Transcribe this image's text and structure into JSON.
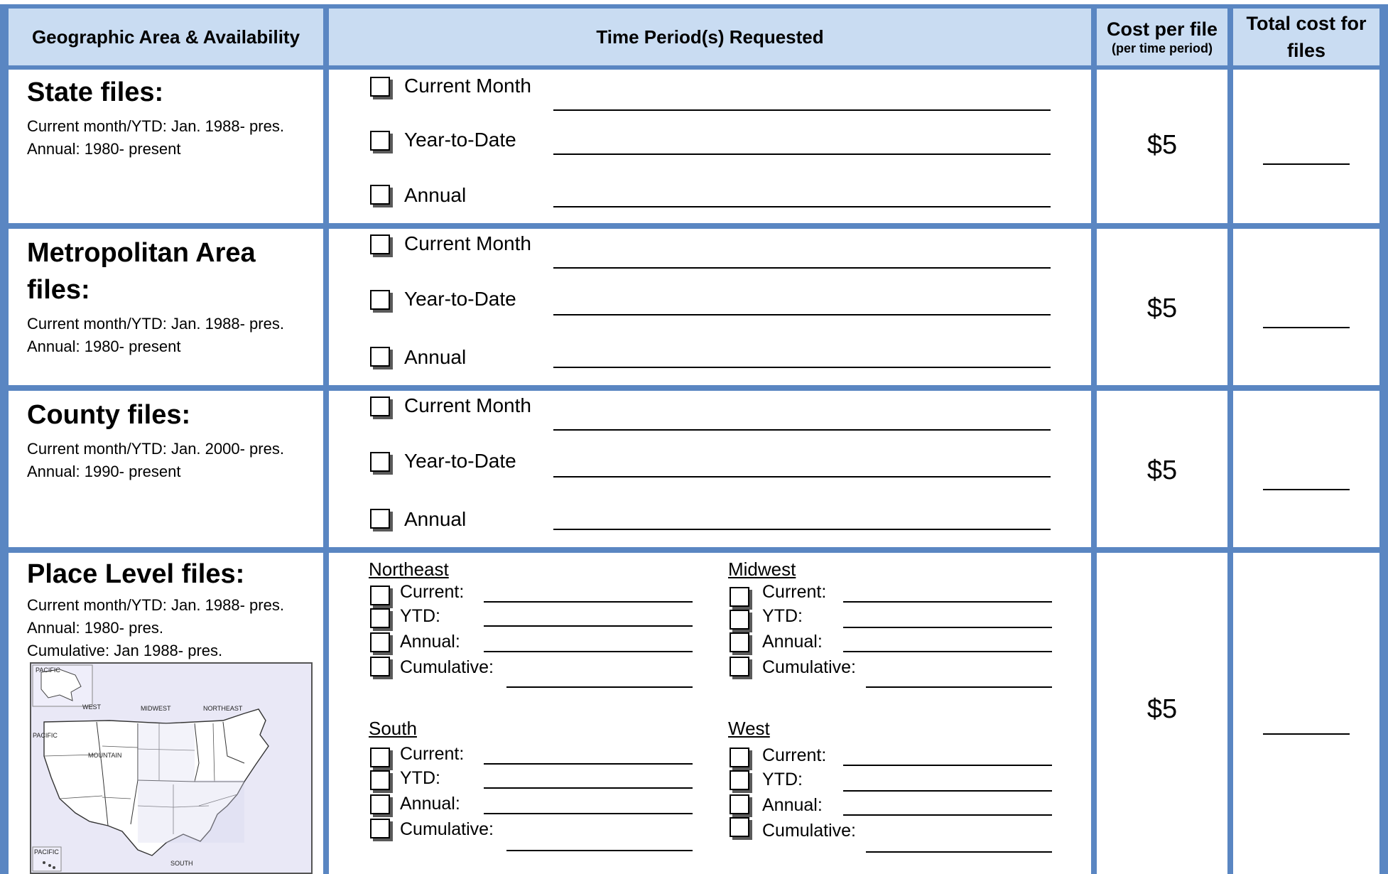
{
  "header": {
    "col1": "Geographic Area & Availability",
    "col2": "Time Period(s) Requested",
    "col3_main": "Cost per file",
    "col3_sub": "(per time period)",
    "col4": "Total cost for files"
  },
  "options": [
    "Current Month",
    "Year-to-Date",
    "Annual"
  ],
  "rows": [
    {
      "title": "State files:",
      "notes": [
        "Current month/YTD: Jan. 1988- pres.",
        "Annual: 1980- present"
      ],
      "cost": "$5"
    },
    {
      "title_line1": "Metropolitan Area",
      "title_line2": "files:",
      "notes": [
        "Current month/YTD: Jan. 1988- pres.",
        "Annual: 1980- present"
      ],
      "cost": "$5"
    },
    {
      "title": "County files:",
      "notes": [
        "Current month/YTD: Jan. 2000- pres.",
        "Annual: 1990- present"
      ],
      "cost": "$5"
    },
    {
      "title": "Place Level files:",
      "notes": [
        "Current month/YTD: Jan. 1988- pres.",
        "Annual: 1980- pres.",
        "Cumulative: Jan 1988- pres."
      ],
      "cost": "$5",
      "regions": [
        "Northeast",
        "Midwest",
        "South",
        "West"
      ],
      "region_options": [
        "Current:",
        "YTD:",
        "Annual:",
        "Cumulative:"
      ],
      "map_labels": [
        "PACIFIC",
        "WEST",
        "MIDWEST",
        "NORTHEAST",
        "PACIFIC",
        "MOUNTAIN",
        "SOUTH",
        "PACIFIC"
      ]
    }
  ],
  "colors": {
    "grid": "#5a86c2",
    "header_fill": "#c9dcf2"
  }
}
